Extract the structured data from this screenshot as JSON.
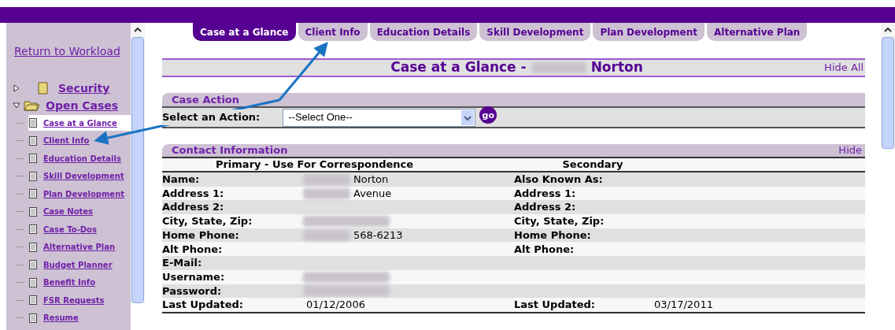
{
  "tabs": [
    {
      "label": "Case at a Glance",
      "selected": true
    },
    {
      "label": "Client Info",
      "selected": false
    },
    {
      "label": "Education Details",
      "selected": false
    },
    {
      "label": "Skill Development",
      "selected": false
    },
    {
      "label": "Plan Development",
      "selected": false
    },
    {
      "label": "Alternative Plan",
      "selected": false
    }
  ],
  "sidebar": {
    "return_link": "Return to Workload",
    "folders": [
      {
        "label": "Security",
        "expanded": false
      },
      {
        "label": "Open Cases",
        "expanded": true,
        "children": [
          {
            "label": "Case at a Glance",
            "selected": true
          },
          {
            "label": "Client Info",
            "selected": false
          },
          {
            "label": "Education Details",
            "selected": false
          },
          {
            "label": "Skill Development",
            "selected": false
          },
          {
            "label": "Plan Development",
            "selected": false
          },
          {
            "label": "Case Notes",
            "selected": false
          },
          {
            "label": "Case To-Dos",
            "selected": false
          },
          {
            "label": "Alternative Plan",
            "selected": false
          },
          {
            "label": "Budget Planner",
            "selected": false
          },
          {
            "label": "Benefit Info",
            "selected": false
          },
          {
            "label": "FSR Requests",
            "selected": false
          },
          {
            "label": "Resume",
            "selected": false
          }
        ]
      }
    ]
  },
  "page_heading": {
    "title": "Case at a Glance -",
    "name": "Norton",
    "name_redacted": true,
    "hide_all": "Hide All"
  },
  "case_action": {
    "title": "Case Action",
    "label": "Select an Action:",
    "select": {
      "value": "--Select One--"
    },
    "go": "go"
  },
  "contact": {
    "title": "Contact Information",
    "hide": "Hide",
    "columns": [
      "Primary - Use For Correspondence",
      "Secondary"
    ],
    "rows": [
      {
        "label": "Name:",
        "value": "Norton",
        "redacted": true,
        "label_2": "Also Known As:"
      },
      {
        "label": "Address 1:",
        "value": "Avenue",
        "redacted": true,
        "label_2": "Address 1:"
      },
      {
        "label": "Address 2:",
        "label_2": "Address 2:"
      },
      {
        "label": "City, State, Zip:",
        "redacted": true,
        "label_2": "City, State, Zip:"
      },
      {
        "label": "Home Phone:",
        "value": "568-6213",
        "redacted": true,
        "label_2": "Home Phone:"
      },
      {
        "label": "Alt Phone:",
        "label_2": "Alt Phone:"
      },
      {
        "label": "E-Mail:"
      },
      {
        "label": "Username:",
        "redacted": true
      },
      {
        "label": "Password:",
        "redacted": true
      },
      {
        "label": "Last Updated:",
        "value": "01/12/2006",
        "label_2": "Last Updated:",
        "value_2": "03/17/2011"
      }
    ]
  }
}
